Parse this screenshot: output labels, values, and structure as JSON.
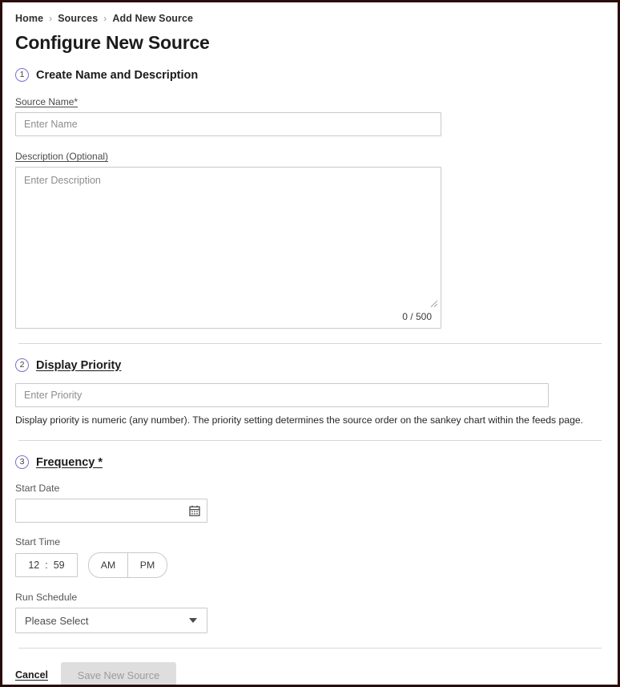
{
  "breadcrumb": {
    "separator": "›",
    "items": [
      {
        "label": "Home"
      },
      {
        "label": "Sources"
      },
      {
        "label": "Add New Source"
      }
    ]
  },
  "page": {
    "title": "Configure New Source"
  },
  "colors": {
    "step_badge_border": "#7d6fd1",
    "input_border": "#c9c9c9",
    "divider": "#d8d8d8",
    "disabled_button_bg": "#dedede",
    "disabled_button_text": "#9b9b9b",
    "page_frame": "#2b0a0a"
  },
  "sections": {
    "name_description": {
      "step": "1",
      "title": "Create Name and Description",
      "source_name": {
        "label": "Source Name*",
        "placeholder": "Enter Name",
        "value": ""
      },
      "description": {
        "label": "Description (Optional)",
        "placeholder": "Enter Description",
        "value": "",
        "counter": "0 / 500",
        "resize_handle_icon": "resize-grip-icon"
      }
    },
    "display_priority": {
      "step": "2",
      "title": "Display Priority",
      "priority": {
        "placeholder": "Enter Priority",
        "value": ""
      },
      "helper_text": "Display priority is numeric (any number). The priority setting determines the source order on the sankey chart within the feeds page."
    },
    "frequency": {
      "step": "3",
      "title": "Frequency *",
      "start_date": {
        "label": "Start Date",
        "value": "",
        "icon": "calendar-icon"
      },
      "start_time": {
        "label": "Start Time",
        "hour": "12",
        "separator": ":",
        "minute": "59",
        "meridiem_options": [
          {
            "label": "AM"
          },
          {
            "label": "PM"
          }
        ]
      },
      "run_schedule": {
        "label": "Run Schedule",
        "selected": "Please Select",
        "caret_icon": "chevron-down-icon"
      }
    }
  },
  "footer": {
    "cancel_label": "Cancel",
    "save_label": "Save New Source"
  }
}
